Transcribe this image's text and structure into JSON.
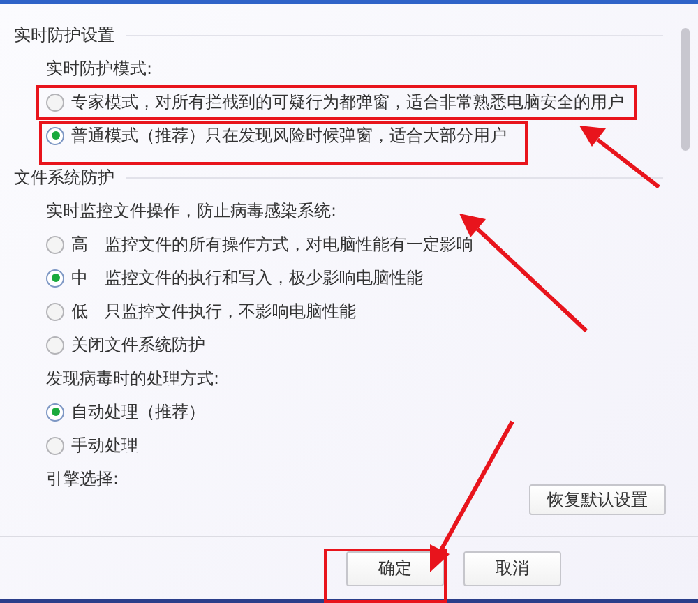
{
  "sections": [
    {
      "title": "实时防护设置",
      "groups": [
        {
          "label": "实时防护模式:",
          "options": [
            {
              "label": "专家模式，对所有拦截到的可疑行为都弹窗，适合非常熟悉电脑安全的用户",
              "selected": false
            },
            {
              "label": "普通模式（推荐）只在发现风险时候弹窗，适合大部分用户",
              "selected": true
            }
          ]
        }
      ]
    },
    {
      "title": "文件系统防护",
      "groups": [
        {
          "label": "实时监控文件操作，防止病毒感染系统:",
          "options": [
            {
              "tag": "高",
              "label": "监控文件的所有操作方式，对电脑性能有一定影响",
              "selected": false
            },
            {
              "tag": "中",
              "label": "监控文件的执行和写入，极少影响电脑性能",
              "selected": true
            },
            {
              "tag": "低",
              "label": "只监控文件执行，不影响电脑性能",
              "selected": false
            },
            {
              "label": "关闭文件系统防护",
              "selected": false
            }
          ]
        },
        {
          "label": "发现病毒时的处理方式:",
          "options": [
            {
              "label": "自动处理（推荐）",
              "selected": true
            },
            {
              "label": "手动处理",
              "selected": false
            }
          ]
        },
        {
          "label": "引擎选择:"
        }
      ]
    }
  ],
  "restore_button": "恢复默认设置",
  "buttons": [
    "确定",
    "取消"
  ]
}
